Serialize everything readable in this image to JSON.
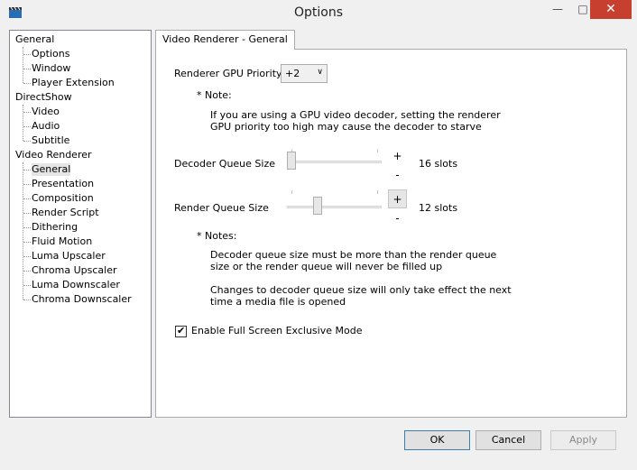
{
  "window": {
    "title": "Options",
    "minimize": "—",
    "maximize": "□",
    "close": "✕"
  },
  "tree": {
    "groups": [
      {
        "label": "General",
        "children": [
          "Options",
          "Window",
          "Player Extension"
        ]
      },
      {
        "label": "DirectShow",
        "children": [
          "Video",
          "Audio",
          "Subtitle"
        ]
      },
      {
        "label": "Video Renderer",
        "children": [
          "General",
          "Presentation",
          "Composition",
          "Render Script",
          "Dithering",
          "Fluid Motion",
          "Luma Upscaler",
          "Chroma Upscaler",
          "Luma Downscaler",
          "Chroma Downscaler"
        ]
      }
    ],
    "selected": "Video Renderer/General"
  },
  "tab": {
    "label": "Video Renderer - General"
  },
  "gpu_priority": {
    "label": "Renderer GPU Priority*",
    "value": "+2",
    "arrow": "∨"
  },
  "note1": {
    "title": "* Note:",
    "line1": "If you are using a GPU video decoder, setting the renderer",
    "line2": "GPU priority too high may cause the decoder to starve"
  },
  "decoder_queue": {
    "label": "Decoder Queue Size",
    "plus": "+",
    "minus": "-",
    "value_text": "16 slots",
    "level": 0.0
  },
  "render_queue": {
    "label": "Render Queue Size",
    "plus": "+",
    "minus": "-",
    "value_text": "12 slots",
    "level": 0.3
  },
  "notes2": {
    "title": "* Notes:",
    "line1": "Decoder queue size must be more than the render queue",
    "line2": "size or the render queue will never be filled up",
    "line3": "Changes to decoder queue size will only take effect the next",
    "line4": "time a media file is opened"
  },
  "fullscreen": {
    "label": "Enable Full Screen Exclusive Mode",
    "checked": true,
    "mark": "✔"
  },
  "buttons": {
    "ok": "OK",
    "cancel": "Cancel",
    "apply": "Apply"
  }
}
